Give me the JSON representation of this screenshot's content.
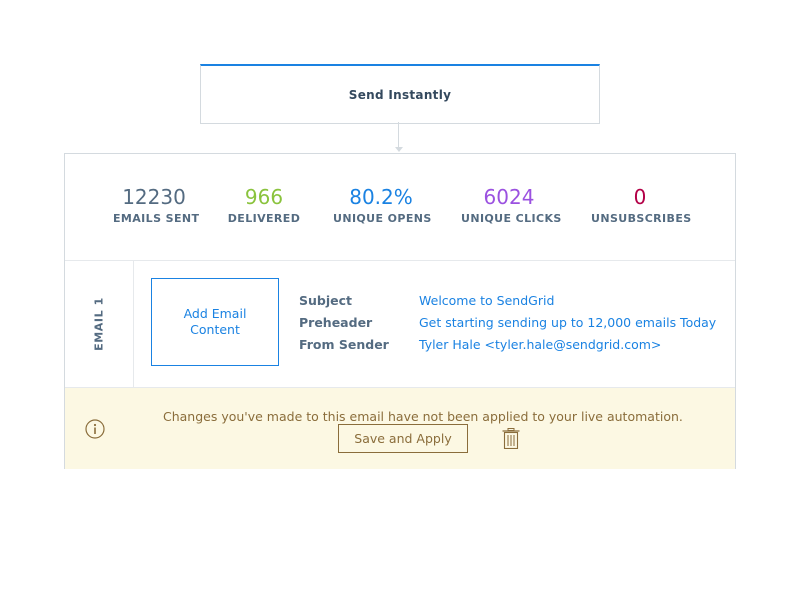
{
  "trigger": {
    "label": "Send Instantly"
  },
  "stats": [
    {
      "value": "12230",
      "label": "EMAILS SENT",
      "color": "#546b81"
    },
    {
      "value": "966",
      "label": "DELIVERED",
      "color": "#8ac33d"
    },
    {
      "value": "80.2%",
      "label": "UNIQUE OPENS",
      "color": "#1a82e2"
    },
    {
      "value": "6024",
      "label": "UNIQUE CLICKS",
      "color": "#9b51e0"
    },
    {
      "value": "0",
      "label": "UNSUBSCRIBES",
      "color": "#b30047"
    }
  ],
  "email": {
    "tab_label": "EMAIL 1",
    "add_content_label": "Add Email Content",
    "fields": [
      {
        "key": "Subject",
        "value": "Welcome to SendGrid"
      },
      {
        "key": "Preheader",
        "value": "Get starting sending up to 12,000 emails Today"
      },
      {
        "key": "From Sender",
        "value": "Tyler Hale <tyler.hale@sendgrid.com>"
      }
    ]
  },
  "alert": {
    "message": "Changes you've made to this email have not been applied to your live automation.",
    "save_label": "Save and Apply",
    "icon": "info-icon",
    "trash_icon": "trash-icon"
  },
  "colors": {
    "accent": "#1a82e2",
    "warning_bg": "#fcf8e3",
    "warning_text": "#8a6d3b"
  }
}
